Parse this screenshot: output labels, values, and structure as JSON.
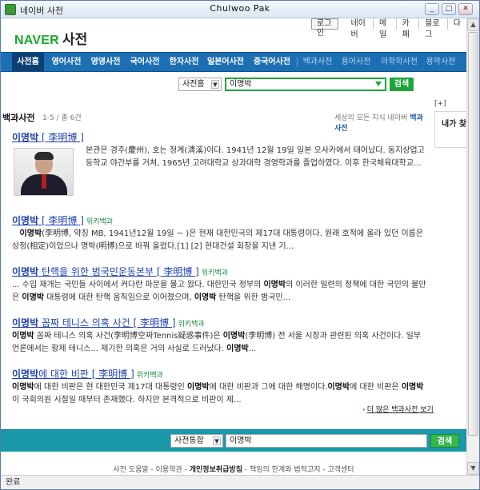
{
  "window": {
    "title": "네이버 사전",
    "user": "Chulwoo Pak",
    "controls": {
      "minimize": "_",
      "maximize": "□",
      "close": "✕"
    }
  },
  "header": {
    "logo_brand": "NAVER",
    "logo_service": "사전",
    "login_label": "로그인",
    "top_links": [
      "네이버",
      "메일",
      "카페",
      "블로그",
      "다"
    ]
  },
  "categories": [
    {
      "label": "사전홈",
      "active": true
    },
    {
      "label": "영어사전"
    },
    {
      "label": "영영사전"
    },
    {
      "label": "국어사전"
    },
    {
      "label": "한자사전"
    },
    {
      "label": "일본어사전"
    },
    {
      "label": "중국어사전"
    },
    {
      "label": "백과사전",
      "dim": true
    },
    {
      "label": "용어사전",
      "dim": true
    },
    {
      "label": "의학학사전",
      "dim": true
    },
    {
      "label": "용악사전",
      "dim": true
    }
  ],
  "search": {
    "scope_selected": "사전홈",
    "query": "이명박",
    "button_label": "검색"
  },
  "section": {
    "title": "백과사전",
    "count": "1-5 / 총 6건",
    "slogan_prefix": "세상의 모든 지식 네이버",
    "slogan_brand": "백과사전"
  },
  "right_panel": {
    "plus_label": "[+]",
    "box_title": "내가 찾"
  },
  "results": [
    {
      "title_kw": "이명박",
      "title_rest": " [ 李明博 ]",
      "wiki": "",
      "desc": "본관은 경주(慶州), 호는 청계(淸溪)이다. 1941년 12월 19일 일본 오사카에서 태어났다. 동지상업고등학교 야간부를 거쳐, 1965년 고려대학교 상과대학 경영학과를 졸업하였다. 이후 한국체육대학교..."
    },
    {
      "title_kw": "이명박",
      "title_rest": " [ 李明博 ]",
      "wiki": "위키백과",
      "desc_kw": "이명박",
      "desc": "(李明博, 약칭 MB, 1941년12월 19일 ~ )은 현재 대한민국의 제17대 대통령이다. 원래 호적에 올라 있던 이름은 상정(相定)이었으나 명박(明博)으로 바꿔 올렸다.[1] [2] 현대건설 회장을 지낸 기..."
    },
    {
      "title_kw": "이명박",
      "title_rest": " 탄핵을 위한 범국민운동본부 [ 李明博 ]",
      "wiki": "위키백과",
      "desc_a": "... 수입 재개는 국민들 사이에서 커다란 파문을 몰고 왔다. 대한민국 정부의 ",
      "desc_kw1": "이명박",
      "desc_b": "의 이러한 일련의 정책에 대한 국민의 불만은 ",
      "desc_kw2": "이명박",
      "desc_c": " 대통령에 대한 탄핵 움직임으로 이어졌으며, ",
      "desc_kw3": "이명박",
      "desc_d": " 탄핵을 위한 범국민..."
    },
    {
      "title_kw": "이명박",
      "title_rest": " 꼼짜 테니스 의혹 사건 [ 李明博 ]",
      "wiki": "위키백과",
      "desc_kw1": "이명박",
      "desc_a": " 꼼짜 테니스 의혹 사건(李明博空짜Tennis疑惑事件)은 ",
      "desc_kw2": "이명박",
      "desc_b": "(李明博) 전 서울 시장과 관련된 의혹 사건이다. 일부 언론에서는 황제 테니스... 제기한 의혹은 거의 사실로 드러났다. ",
      "desc_kw3": "이명박",
      "desc_c": "..."
    },
    {
      "title_kw": "이명박",
      "title_rest": "에 대한 비판 [ 李明博 ]",
      "wiki": "위키백과",
      "desc_kw1": "이명박",
      "desc_a": "에 대한 비판은 현 대한민국 제17대 대통령인 ",
      "desc_kw2": "이명박",
      "desc_b": "에 대한 비판과 그에 대한 해명이다.",
      "desc_kw3": "이명박",
      "desc_c": "에 대한 비판은 ",
      "desc_kw4": "이명박",
      "desc_d": "이 국회의원 시절일 때부터 존재했다. 하지만 본격적으로 비판이 제..."
    }
  ],
  "more_link": {
    "chev": "›",
    "label": "더 많은 백과사전 보기"
  },
  "bottom_search": {
    "scope_selected": "사전통합",
    "query": "이명박",
    "button_label": "검색"
  },
  "footer": {
    "left": "사전 도움말 - 이용약관 - ",
    "bold": "개인정보취급방침",
    "right": " - 책임의 한계와 법적고지 - 고객센터"
  },
  "status": {
    "text": "완료"
  }
}
